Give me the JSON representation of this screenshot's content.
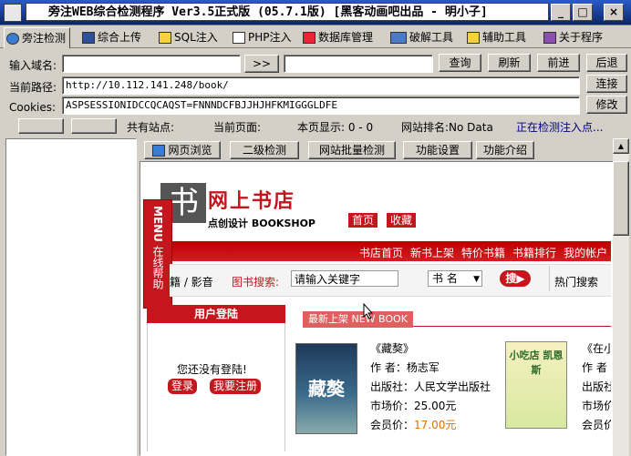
{
  "window": {
    "title": "旁注WEB综合检测程序 Ver3.5正式版 (05.7.1版) [黑客动画吧出品 - 明小子]"
  },
  "tabs": [
    {
      "label": "旁注检测",
      "active": true
    },
    {
      "label": "综合上传"
    },
    {
      "label": "SQL注入"
    },
    {
      "label": "PHP注入"
    },
    {
      "label": "数据库管理"
    },
    {
      "label": "破解工具"
    },
    {
      "label": "辅助工具"
    },
    {
      "label": "关于程序"
    }
  ],
  "form": {
    "domain_label": "输入域名:",
    "domain_value": "",
    "arrow_label": ">>",
    "extra_value": "",
    "path_label": "当前路径:",
    "path_value": "http://10.112.141.248/book/",
    "cookies_label": "Cookies:",
    "cookies_value": "ASPSESSIONIDCCQCAQST=FNNNDCFBJJHJHFKMIGGGLDFE"
  },
  "buttons": {
    "query": "查询",
    "refresh": "刷新",
    "forward": "前进",
    "back": "后退",
    "connect": "连接",
    "modify": "修改"
  },
  "status": {
    "shared_sites": "共有站点:",
    "current_page": "当前页面:",
    "page_display": "本页显示: 0 - 0",
    "site_rank": "网站排名:No Data",
    "detecting": "正在检测注入点..."
  },
  "subtabs": [
    "网页浏览",
    "二级检测",
    "网站批量检测",
    "功能设置",
    "功能介绍"
  ],
  "webpage": {
    "logo_char": "书",
    "shop_name": "网上书店",
    "shop_sub": "点创设计 BOOKSHOP",
    "top_links": [
      "首页",
      "收藏"
    ],
    "nav": [
      "书店首页",
      "新书上架",
      "特价书籍",
      "书籍排行",
      "我的帐户"
    ],
    "side_menu_title": "MENU",
    "side_menu_sub": "在线帮助",
    "search_prefix": "籍 / 影音",
    "search_label": "图书搜索:",
    "search_placeholder": "请输入关键字",
    "search_type": "书  名",
    "search_button": "搜",
    "hot_search": "热门搜索",
    "login_title": "用户登陆",
    "login_msg": "您还没有登陆!",
    "login_btn": "登录",
    "register_btn": "我要注册",
    "new_books_title": "最新上架 NEW BOOK",
    "book1": {
      "cover_text": "藏獒",
      "title": "《藏獒》",
      "author": "作  者：杨志军",
      "publisher": "出版社：人民文学出版社",
      "market_price": "市场价：25.00元",
      "member_price_label": "会员价：",
      "member_price": "17.00元"
    },
    "book2": {
      "cover_text": "小吃店 凯恩斯",
      "title": "《在小",
      "author": "作  者",
      "publisher": "出版社",
      "market_price": "市场价",
      "member_price": "会员价"
    }
  },
  "colors": {
    "accent_red": "#c4161c",
    "title_blue": "#0a246a",
    "link_blue": "#000080"
  }
}
